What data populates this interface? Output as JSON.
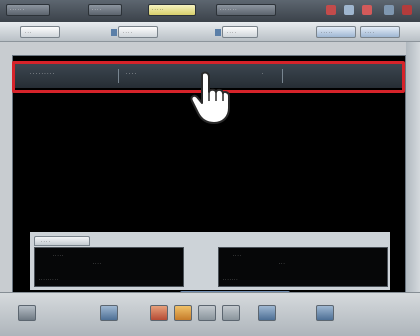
{
  "topbar": {
    "items": [
      {
        "label": "· · · · · ·"
      },
      {
        "label": "· · · ·"
      },
      {
        "label": "· · · · ·"
      },
      {
        "label": "· · · · · · ·"
      }
    ]
  },
  "toolbar2": {
    "tabs": [
      {
        "label": "· · ·"
      },
      {
        "label": "· · · ·"
      },
      {
        "label": "· · · ·"
      },
      {
        "label": "· · · · ·"
      },
      {
        "label": "· · · ·"
      }
    ]
  },
  "list_header": {
    "columns": [
      {
        "label": "· · · · · · · · ·"
      },
      {
        "label": "· · · ·"
      },
      {
        "label": "·"
      }
    ]
  },
  "detail": {
    "tab_label": "· · · ·",
    "left_box": [
      "· · ·  · ·",
      "· · · ·",
      "· · · · · · · · ·"
    ],
    "right_box": [
      "· ·  · ·",
      "· · ·",
      "· · · · · · ·"
    ]
  },
  "colors": {
    "highlight": "#d6232a",
    "panel": "#000000",
    "header": "#2f3840"
  },
  "icons": [
    "pointer-hand-icon",
    "settings-icon",
    "print-icon",
    "save-icon",
    "exit-icon"
  ]
}
